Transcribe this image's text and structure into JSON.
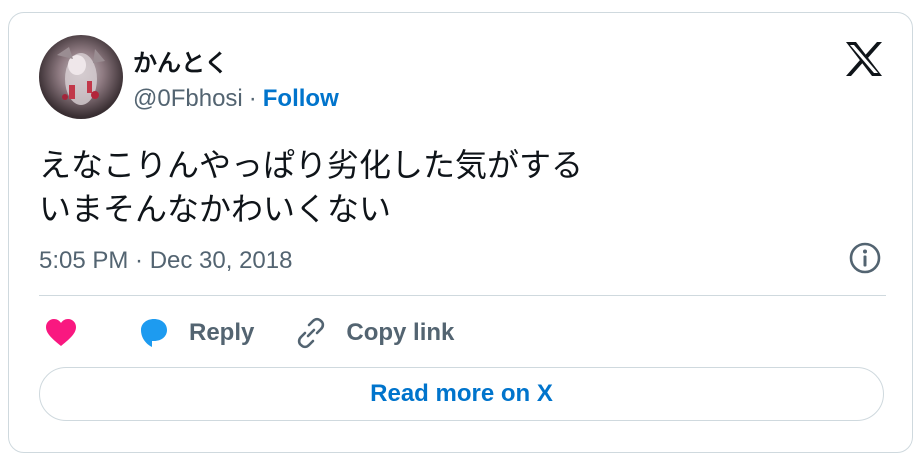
{
  "author": {
    "display_name": "かんとく",
    "handle": "@0Fbhosi",
    "separator": "·",
    "follow_label": "Follow"
  },
  "tweet": {
    "text": "えなこりんやっぱり劣化した気がする\nいまそんなかわいくない",
    "timestamp": "5:05 PM · Dec 30, 2018"
  },
  "actions": {
    "reply_label": "Reply",
    "copy_link_label": "Copy link"
  },
  "footer": {
    "read_more_label": "Read more on X"
  },
  "colors": {
    "accent": "#0074cc",
    "like": "#f91880",
    "reply": "#1d9bf0",
    "muted": "#536471",
    "text": "#0f1419",
    "border": "#cfd9de"
  },
  "icons": [
    "x-logo-icon",
    "info-icon",
    "heart-icon",
    "reply-bubble-icon",
    "link-icon"
  ]
}
